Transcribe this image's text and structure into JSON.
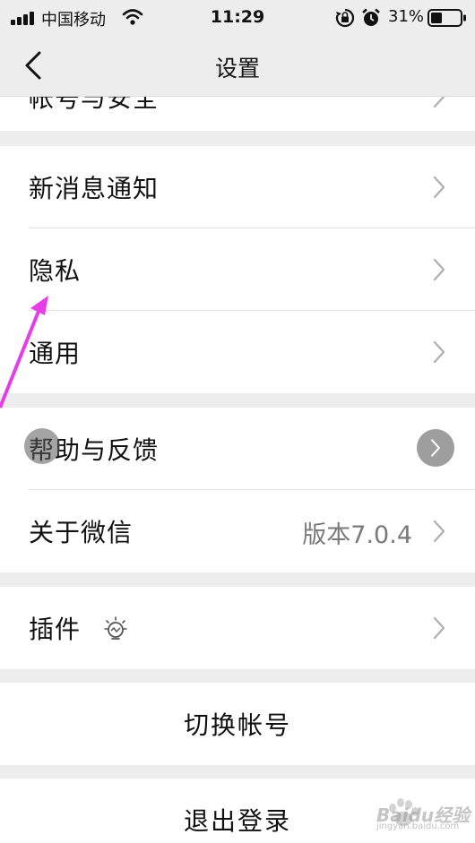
{
  "status": {
    "carrier": "中国移动",
    "time": "11:29",
    "battery": "31%"
  },
  "nav": {
    "title": "设置"
  },
  "partial_row": {
    "label": "帐号与安全"
  },
  "group1": [
    {
      "label": "新消息通知"
    },
    {
      "label": "隐私"
    },
    {
      "label": "通用"
    }
  ],
  "group2": [
    {
      "label": "帮助与反馈"
    },
    {
      "label": "关于微信",
      "value": "版本7.0.4"
    }
  ],
  "group3": [
    {
      "label": "插件"
    }
  ],
  "actions": {
    "switch_account": "切换帐号",
    "logout": "退出登录"
  },
  "watermark": {
    "brand": "Baidu经验",
    "url": "jingyan.baidu.com"
  },
  "colors": {
    "background": "#ededed",
    "cell": "#ffffff",
    "secondary_text": "#7a7a7a",
    "annotation_arrow": "#e63ee6"
  }
}
